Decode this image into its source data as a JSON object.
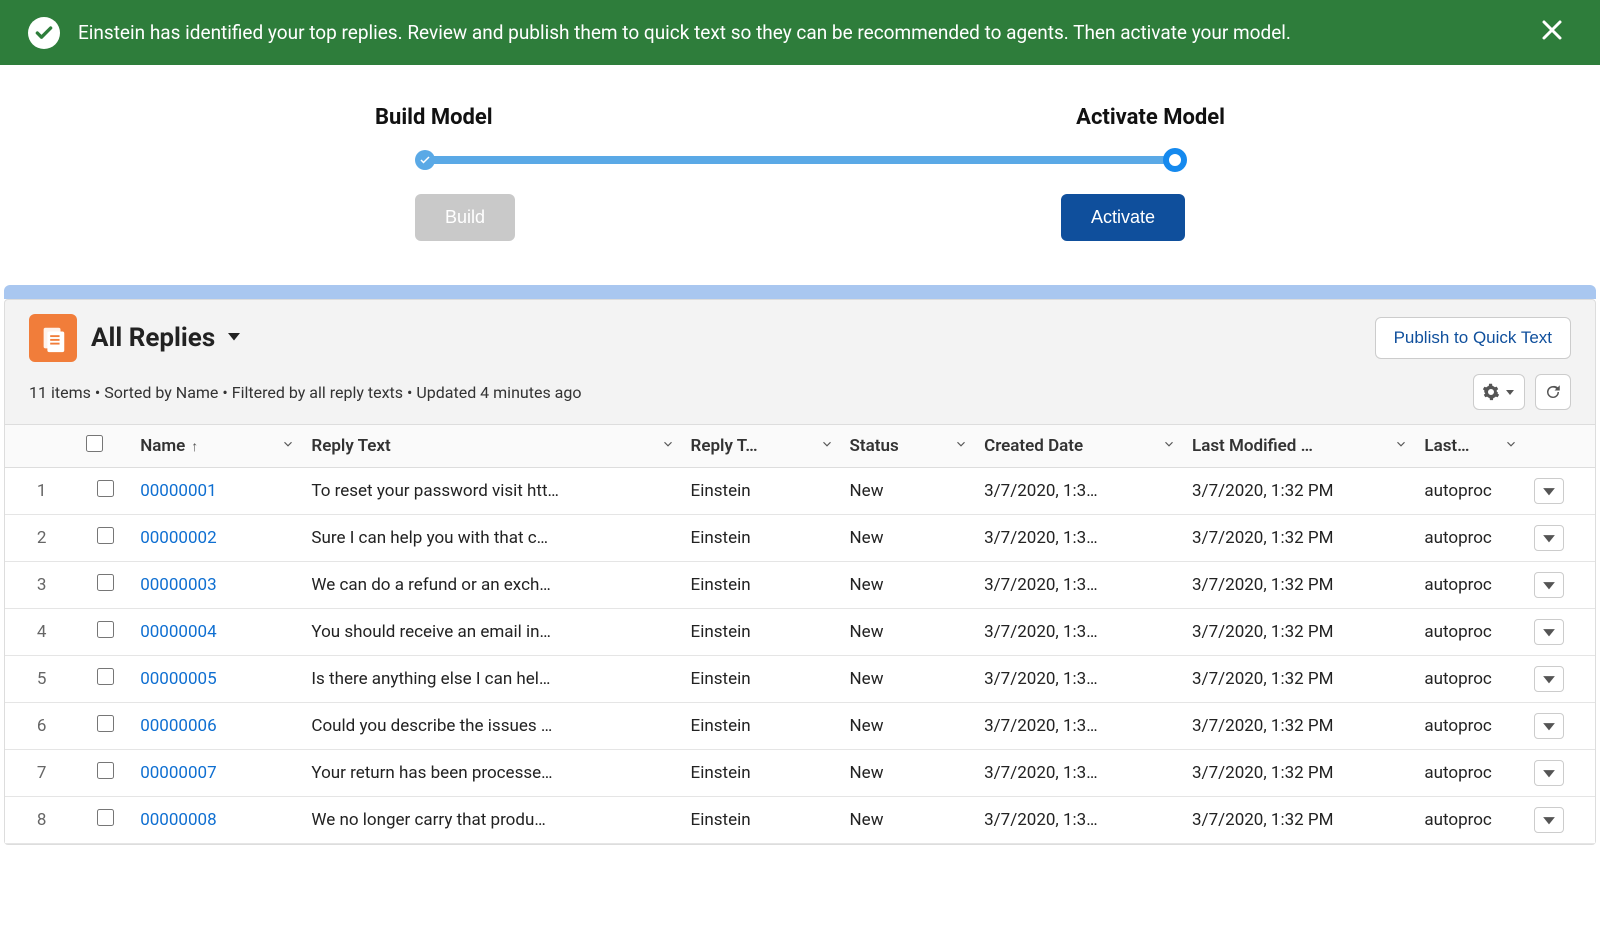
{
  "banner": {
    "message": "Einstein has identified your top replies. Review and publish them to quick text so they can be recommended to agents. Then activate your model."
  },
  "progress": {
    "steps": [
      "Build Model",
      "Activate Model"
    ],
    "build_button": "Build",
    "activate_button": "Activate"
  },
  "list": {
    "title": "All Replies",
    "publish_button": "Publish to Quick Text",
    "meta": "11 items • Sorted by Name • Filtered by all reply texts • Updated 4 minutes ago"
  },
  "columns": {
    "name": "Name",
    "reply_text": "Reply Text",
    "reply_t2": "Reply T…",
    "status": "Status",
    "created": "Created Date",
    "modified": "Last Modified …",
    "last": "Last…"
  },
  "rows": [
    {
      "num": "1",
      "name": "00000001",
      "reply": "To reset your password visit htt…",
      "t2": "Einstein",
      "status": "New",
      "created": "3/7/2020, 1:3…",
      "modified": "3/7/2020, 1:32 PM",
      "last": "autoproc"
    },
    {
      "num": "2",
      "name": "00000002",
      "reply": "Sure I can help you with that c…",
      "t2": "Einstein",
      "status": "New",
      "created": "3/7/2020, 1:3…",
      "modified": "3/7/2020, 1:32 PM",
      "last": "autoproc"
    },
    {
      "num": "3",
      "name": "00000003",
      "reply": "We can do a refund or an exch…",
      "t2": "Einstein",
      "status": "New",
      "created": "3/7/2020, 1:3…",
      "modified": "3/7/2020, 1:32 PM",
      "last": "autoproc"
    },
    {
      "num": "4",
      "name": "00000004",
      "reply": "You should receive an email in…",
      "t2": "Einstein",
      "status": "New",
      "created": "3/7/2020, 1:3…",
      "modified": "3/7/2020, 1:32 PM",
      "last": "autoproc"
    },
    {
      "num": "5",
      "name": "00000005",
      "reply": "Is there anything else I can hel…",
      "t2": "Einstein",
      "status": "New",
      "created": "3/7/2020, 1:3…",
      "modified": "3/7/2020, 1:32 PM",
      "last": "autoproc"
    },
    {
      "num": "6",
      "name": "00000006",
      "reply": "Could you describe the issues …",
      "t2": "Einstein",
      "status": "New",
      "created": "3/7/2020, 1:3…",
      "modified": "3/7/2020, 1:32 PM",
      "last": "autoproc"
    },
    {
      "num": "7",
      "name": "00000007",
      "reply": "Your return has been processe…",
      "t2": "Einstein",
      "status": "New",
      "created": "3/7/2020, 1:3…",
      "modified": "3/7/2020, 1:32 PM",
      "last": "autoproc"
    },
    {
      "num": "8",
      "name": "00000008",
      "reply": "We no longer carry that produ…",
      "t2": "Einstein",
      "status": "New",
      "created": "3/7/2020, 1:3…",
      "modified": "3/7/2020, 1:32 PM",
      "last": "autoproc"
    }
  ]
}
